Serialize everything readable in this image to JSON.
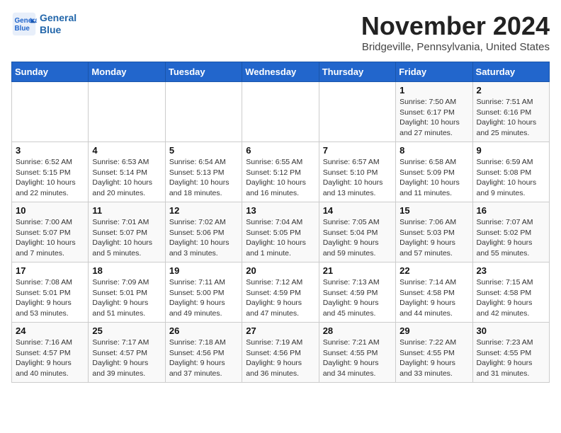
{
  "header": {
    "logo_line1": "General",
    "logo_line2": "Blue",
    "month": "November 2024",
    "location": "Bridgeville, Pennsylvania, United States"
  },
  "weekdays": [
    "Sunday",
    "Monday",
    "Tuesday",
    "Wednesday",
    "Thursday",
    "Friday",
    "Saturday"
  ],
  "weeks": [
    [
      {
        "day": "",
        "info": ""
      },
      {
        "day": "",
        "info": ""
      },
      {
        "day": "",
        "info": ""
      },
      {
        "day": "",
        "info": ""
      },
      {
        "day": "",
        "info": ""
      },
      {
        "day": "1",
        "info": "Sunrise: 7:50 AM\nSunset: 6:17 PM\nDaylight: 10 hours\nand 27 minutes."
      },
      {
        "day": "2",
        "info": "Sunrise: 7:51 AM\nSunset: 6:16 PM\nDaylight: 10 hours\nand 25 minutes."
      }
    ],
    [
      {
        "day": "3",
        "info": "Sunrise: 6:52 AM\nSunset: 5:15 PM\nDaylight: 10 hours\nand 22 minutes."
      },
      {
        "day": "4",
        "info": "Sunrise: 6:53 AM\nSunset: 5:14 PM\nDaylight: 10 hours\nand 20 minutes."
      },
      {
        "day": "5",
        "info": "Sunrise: 6:54 AM\nSunset: 5:13 PM\nDaylight: 10 hours\nand 18 minutes."
      },
      {
        "day": "6",
        "info": "Sunrise: 6:55 AM\nSunset: 5:12 PM\nDaylight: 10 hours\nand 16 minutes."
      },
      {
        "day": "7",
        "info": "Sunrise: 6:57 AM\nSunset: 5:10 PM\nDaylight: 10 hours\nand 13 minutes."
      },
      {
        "day": "8",
        "info": "Sunrise: 6:58 AM\nSunset: 5:09 PM\nDaylight: 10 hours\nand 11 minutes."
      },
      {
        "day": "9",
        "info": "Sunrise: 6:59 AM\nSunset: 5:08 PM\nDaylight: 10 hours\nand 9 minutes."
      }
    ],
    [
      {
        "day": "10",
        "info": "Sunrise: 7:00 AM\nSunset: 5:07 PM\nDaylight: 10 hours\nand 7 minutes."
      },
      {
        "day": "11",
        "info": "Sunrise: 7:01 AM\nSunset: 5:07 PM\nDaylight: 10 hours\nand 5 minutes."
      },
      {
        "day": "12",
        "info": "Sunrise: 7:02 AM\nSunset: 5:06 PM\nDaylight: 10 hours\nand 3 minutes."
      },
      {
        "day": "13",
        "info": "Sunrise: 7:04 AM\nSunset: 5:05 PM\nDaylight: 10 hours\nand 1 minute."
      },
      {
        "day": "14",
        "info": "Sunrise: 7:05 AM\nSunset: 5:04 PM\nDaylight: 9 hours\nand 59 minutes."
      },
      {
        "day": "15",
        "info": "Sunrise: 7:06 AM\nSunset: 5:03 PM\nDaylight: 9 hours\nand 57 minutes."
      },
      {
        "day": "16",
        "info": "Sunrise: 7:07 AM\nSunset: 5:02 PM\nDaylight: 9 hours\nand 55 minutes."
      }
    ],
    [
      {
        "day": "17",
        "info": "Sunrise: 7:08 AM\nSunset: 5:01 PM\nDaylight: 9 hours\nand 53 minutes."
      },
      {
        "day": "18",
        "info": "Sunrise: 7:09 AM\nSunset: 5:01 PM\nDaylight: 9 hours\nand 51 minutes."
      },
      {
        "day": "19",
        "info": "Sunrise: 7:11 AM\nSunset: 5:00 PM\nDaylight: 9 hours\nand 49 minutes."
      },
      {
        "day": "20",
        "info": "Sunrise: 7:12 AM\nSunset: 4:59 PM\nDaylight: 9 hours\nand 47 minutes."
      },
      {
        "day": "21",
        "info": "Sunrise: 7:13 AM\nSunset: 4:59 PM\nDaylight: 9 hours\nand 45 minutes."
      },
      {
        "day": "22",
        "info": "Sunrise: 7:14 AM\nSunset: 4:58 PM\nDaylight: 9 hours\nand 44 minutes."
      },
      {
        "day": "23",
        "info": "Sunrise: 7:15 AM\nSunset: 4:58 PM\nDaylight: 9 hours\nand 42 minutes."
      }
    ],
    [
      {
        "day": "24",
        "info": "Sunrise: 7:16 AM\nSunset: 4:57 PM\nDaylight: 9 hours\nand 40 minutes."
      },
      {
        "day": "25",
        "info": "Sunrise: 7:17 AM\nSunset: 4:57 PM\nDaylight: 9 hours\nand 39 minutes."
      },
      {
        "day": "26",
        "info": "Sunrise: 7:18 AM\nSunset: 4:56 PM\nDaylight: 9 hours\nand 37 minutes."
      },
      {
        "day": "27",
        "info": "Sunrise: 7:19 AM\nSunset: 4:56 PM\nDaylight: 9 hours\nand 36 minutes."
      },
      {
        "day": "28",
        "info": "Sunrise: 7:21 AM\nSunset: 4:55 PM\nDaylight: 9 hours\nand 34 minutes."
      },
      {
        "day": "29",
        "info": "Sunrise: 7:22 AM\nSunset: 4:55 PM\nDaylight: 9 hours\nand 33 minutes."
      },
      {
        "day": "30",
        "info": "Sunrise: 7:23 AM\nSunset: 4:55 PM\nDaylight: 9 hours\nand 31 minutes."
      }
    ]
  ]
}
